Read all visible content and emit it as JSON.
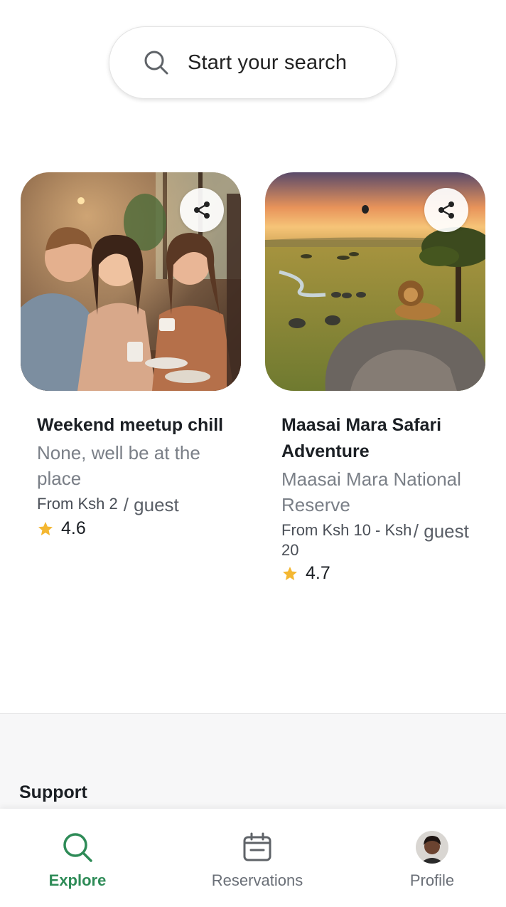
{
  "search": {
    "label": "Start your search"
  },
  "cards": [
    {
      "title": "Weekend meetup chill",
      "location": "None, well be at the place",
      "price": "From Ksh 2",
      "per": "/ guest",
      "rating": "4.6",
      "image": "friends-at-cafe"
    },
    {
      "title": "Maasai Mara Safari Adventure",
      "location": "Maasai Mara National Reserve",
      "price": "From Ksh 10 - Ksh 20",
      "per": "/ guest",
      "rating": "4.7",
      "image": "savanna-lion-sunset"
    }
  ],
  "footer": {
    "support_heading": "Support"
  },
  "nav": {
    "explore": "Explore",
    "reservations": "Reservations",
    "profile": "Profile"
  },
  "colors": {
    "accent": "#2e8b57",
    "star": "#f4b731",
    "muted": "#7a7f87"
  },
  "icons": [
    "search-icon",
    "share-icon",
    "star-icon",
    "calendar-icon",
    "avatar"
  ]
}
